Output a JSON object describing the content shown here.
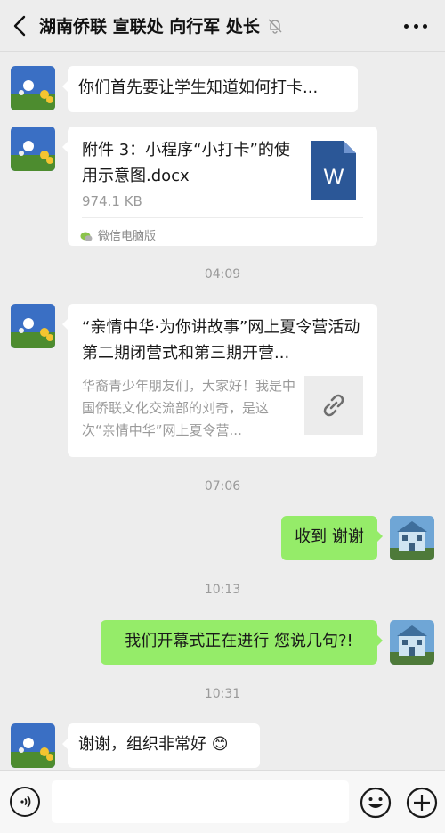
{
  "header": {
    "title": "湖南侨联 宣联处 向行军 处长",
    "back_icon": "chevron-left-icon",
    "mute_icon": "bell-off-icon",
    "more_icon": "more-dots-icon"
  },
  "messages": {
    "m1": {
      "side": "left",
      "text": "你们首先要让学生知道如何打卡..."
    },
    "m2": {
      "side": "left",
      "file_name": "附件 3：小程序“小打卡”的使用示意图.docx",
      "file_size": "974.1 KB",
      "file_icon": "W",
      "source": "微信电脑版"
    },
    "t1": "04:09",
    "m3": {
      "side": "left",
      "title": "“亲情中华·为你讲故事”网上夏令营活动 第二期闭营式和第三期开营...",
      "desc": "华裔青少年朋友们，大家好！我是中国侨联文化交流部的刘奇，是这次“亲情中华”网上夏令营...",
      "thumb_icon": "link-icon"
    },
    "t2": "07:06",
    "m4": {
      "side": "right",
      "text": "收到 谢谢"
    },
    "t3": "10:13",
    "m5": {
      "side": "right",
      "text": "我们开幕式正在进行 您说几句?!"
    },
    "t4": "10:31",
    "m6": {
      "side": "left",
      "text": "谢谢，组织非常好",
      "emoji": "😊"
    }
  },
  "composer": {
    "voice_icon": "voice-icon",
    "input_value": "",
    "emoji_icon": "emoji-icon",
    "plus_icon": "plus-icon"
  },
  "colors": {
    "background": "#ededed",
    "bubble_self": "#95ec69",
    "bubble_other": "#ffffff",
    "word_blue": "#2b5797"
  }
}
